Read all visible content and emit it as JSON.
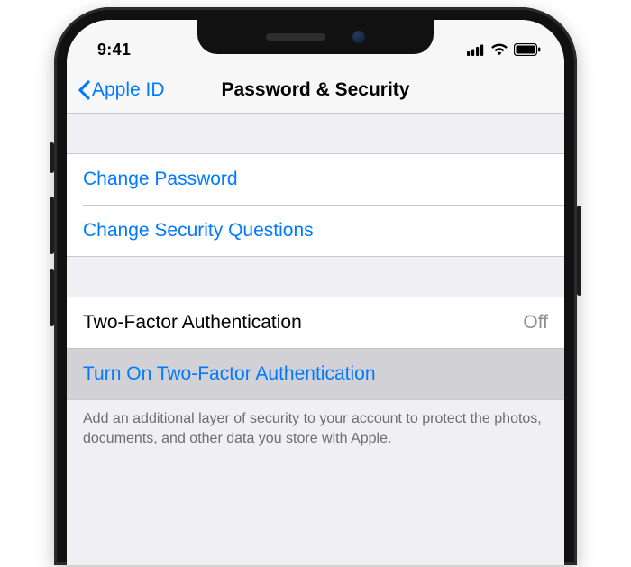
{
  "statusBar": {
    "time": "9:41"
  },
  "nav": {
    "back": "Apple ID",
    "title": "Password & Security"
  },
  "group1": {
    "changePassword": "Change Password",
    "changeSecurityQuestions": "Change Security Questions"
  },
  "group2": {
    "twoFactorLabel": "Two-Factor Authentication",
    "twoFactorValue": "Off",
    "turnOn": "Turn On Two-Factor Authentication",
    "footer": "Add an additional layer of security to your account to protect the photos, documents, and other data you store with Apple."
  },
  "colors": {
    "tint": "#007aff",
    "grouped_bg": "#efeff4",
    "separator": "#c8c7cc",
    "secondary_label": "#8e8e93",
    "footer_label": "#6d6d72",
    "selected_bg": "#d1d1d6"
  }
}
